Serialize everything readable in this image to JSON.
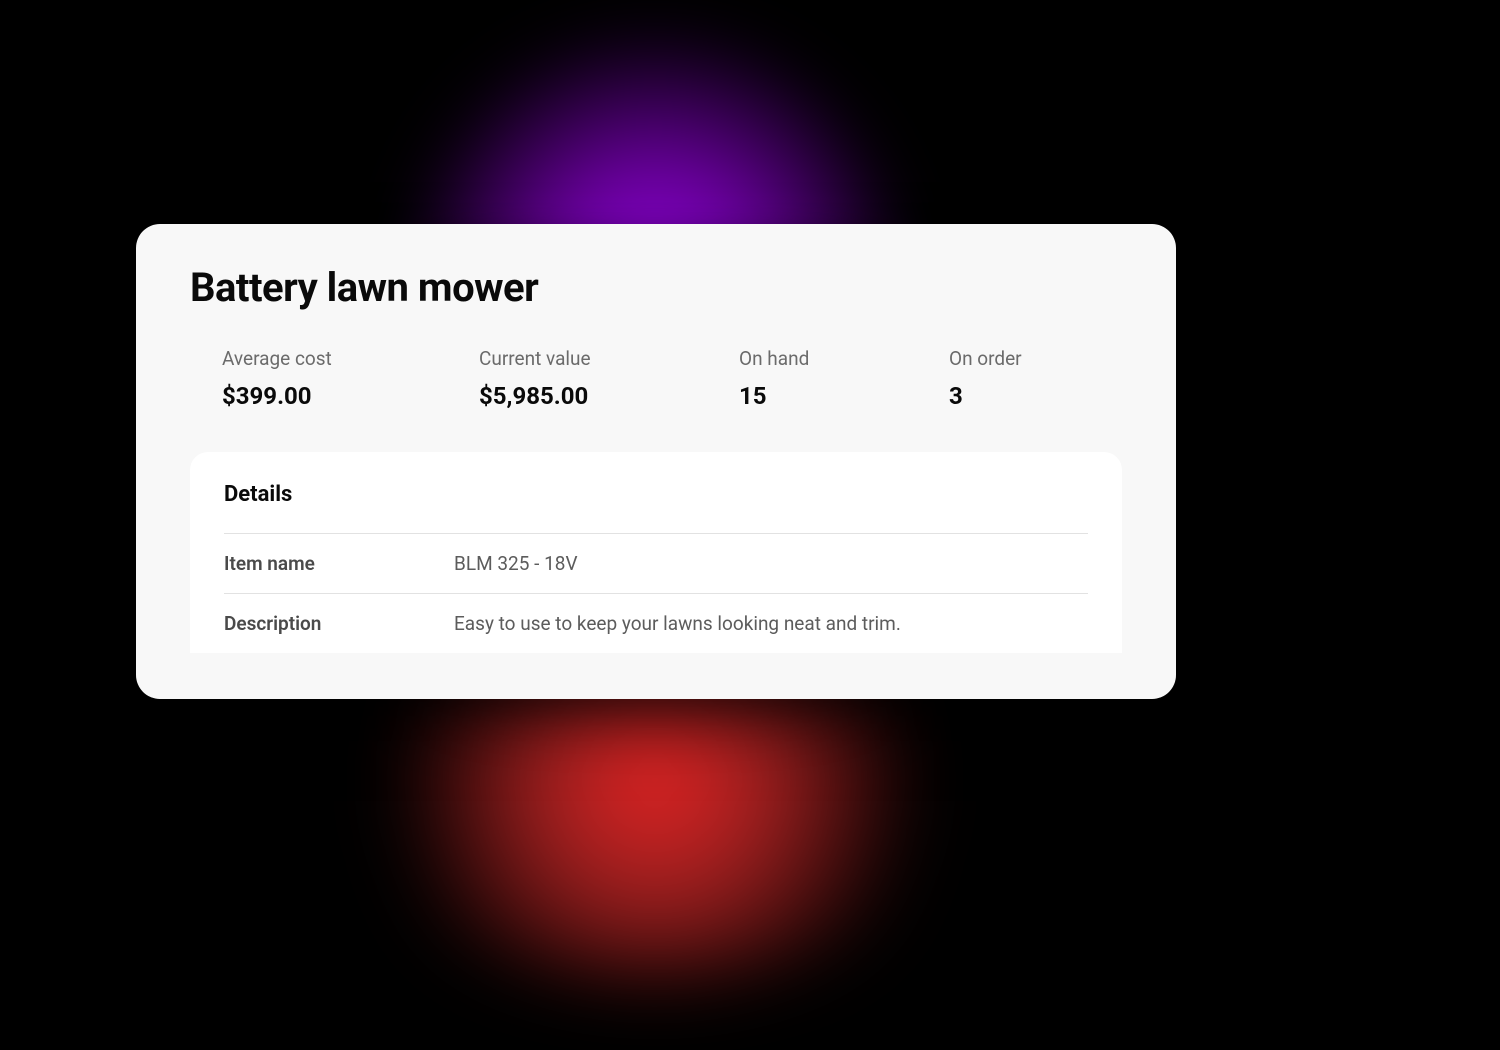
{
  "product": {
    "title": "Battery lawn mower"
  },
  "stats": {
    "average_cost": {
      "label": "Average cost",
      "value": "$399.00"
    },
    "current_value": {
      "label": "Current value",
      "value": "$5,985.00"
    },
    "on_hand": {
      "label": "On hand",
      "value": "15"
    },
    "on_order": {
      "label": "On order",
      "value": "3"
    }
  },
  "details": {
    "heading": "Details",
    "rows": {
      "item_name": {
        "label": "Item name",
        "value": "BLM 325 - 18V"
      },
      "description": {
        "label": "Description",
        "value": "Easy to use to keep your lawns looking neat and trim."
      }
    }
  }
}
